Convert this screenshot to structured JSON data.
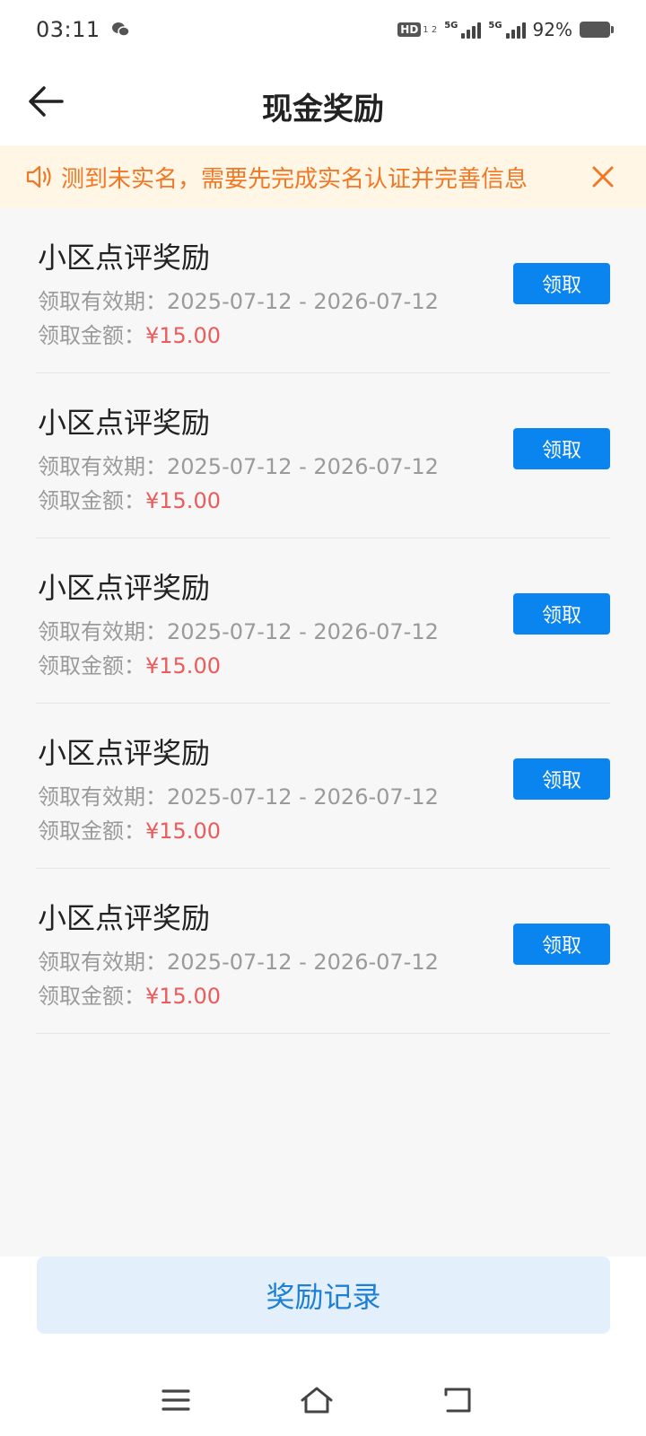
{
  "status_bar": {
    "time": "03:11",
    "hd_label": "HD",
    "hd_sub": "1 2",
    "signal1_label": "5G",
    "signal2_label": "5G",
    "battery_percent": "92%",
    "battery_level": 0.92
  },
  "header": {
    "title": "现金奖励"
  },
  "notice": {
    "text": "测到未实名，需要先完成实名认证并完善信息",
    "color": "#f07826"
  },
  "rewards": [
    {
      "title": "小区点评奖励",
      "period_label": "领取有效期：",
      "period": "2025-07-12 - 2026-07-12",
      "amount_label": "领取金额：",
      "amount": "¥15.00",
      "button": "领取"
    },
    {
      "title": "小区点评奖励",
      "period_label": "领取有效期：",
      "period": "2025-07-12 - 2026-07-12",
      "amount_label": "领取金额：",
      "amount": "¥15.00",
      "button": "领取"
    },
    {
      "title": "小区点评奖励",
      "period_label": "领取有效期：",
      "period": "2025-07-12 - 2026-07-12",
      "amount_label": "领取金额：",
      "amount": "¥15.00",
      "button": "领取"
    },
    {
      "title": "小区点评奖励",
      "period_label": "领取有效期：",
      "period": "2025-07-12 - 2026-07-12",
      "amount_label": "领取金额：",
      "amount": "¥15.00",
      "button": "领取"
    },
    {
      "title": "小区点评奖励",
      "period_label": "领取有效期：",
      "period": "2025-07-12 - 2026-07-12",
      "amount_label": "领取金额：",
      "amount": "¥15.00",
      "button": "领取"
    }
  ],
  "footer": {
    "record_button": "奖励记录"
  },
  "colors": {
    "accent": "#0a84ee",
    "amount": "#ee5a5a",
    "notice_bg": "#fff6e6"
  },
  "icons": {
    "back": "arrow-left-icon",
    "notice": "speaker-icon",
    "close": "close-icon",
    "menu": "menu-icon",
    "home": "home-icon",
    "return": "return-icon"
  }
}
